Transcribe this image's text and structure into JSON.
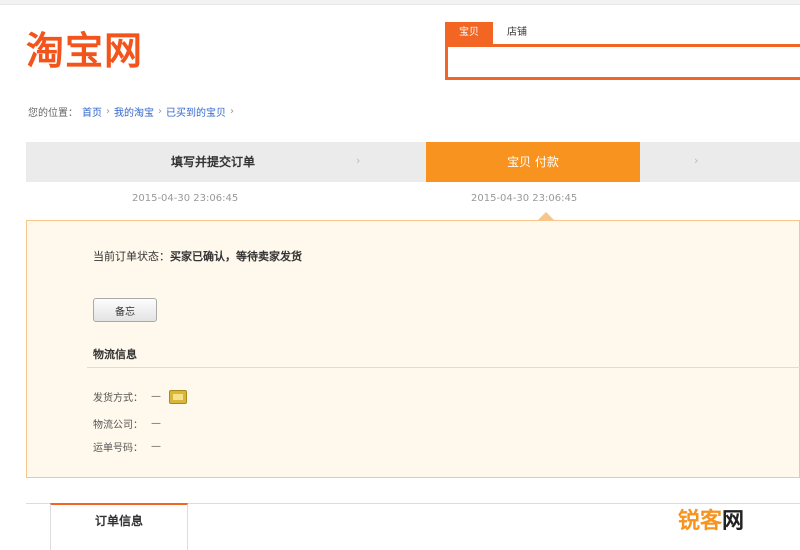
{
  "logo": "淘宝网",
  "search": {
    "tabs": [
      "宝贝",
      "店铺"
    ],
    "placeholder": ""
  },
  "breadcrumb": {
    "prefix": "您的位置：",
    "items": [
      "首页",
      "我的淘宝",
      "已买到的宝贝"
    ],
    "separator": "›"
  },
  "steps": {
    "step1_label": "填写并提交订单",
    "step1_time": "2015-04-30 23:06:45",
    "step2_label": "宝贝 付款",
    "step2_time": "2015-04-30 23:06:45",
    "arrow": "›"
  },
  "status": {
    "label": "当前订单状态：",
    "value": "买家已确认，等待卖家发货",
    "note_button": "备忘"
  },
  "logistics": {
    "title": "物流信息",
    "rows": [
      {
        "label": "发货方式：",
        "value": "—"
      },
      {
        "label": "物流公司：",
        "value": "—"
      },
      {
        "label": "运单号码：",
        "value": "—"
      }
    ]
  },
  "tabs": {
    "order_info": "订单信息"
  },
  "watermark": {
    "part1": "锐客",
    "part2": "网"
  },
  "colors": {
    "brand": "#f2541b",
    "accent": "#f7931e",
    "panel_bg": "#fff8ec"
  }
}
